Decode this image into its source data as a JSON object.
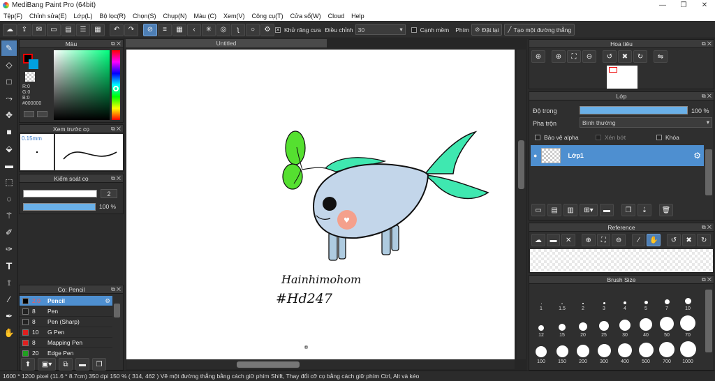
{
  "app": {
    "title": "MediBang Paint Pro (64bit)"
  },
  "menu": [
    "Tệp(F)",
    "Chỉnh sửa(E)",
    "Lớp(L)",
    "Bộ lọc(R)",
    "Chọn(S)",
    "Chụp(N)",
    "Màu (C)",
    "Xem(V)",
    "Công cụ(T)",
    "Cửa sổ(W)",
    "Cloud",
    "Help"
  ],
  "toolbar": {
    "antialias": "Khử răng cưa",
    "adjust": "Điều chỉnh",
    "adjust_value": "30",
    "edge": "Cạnh mềm",
    "key_label": "Phím",
    "reset": "Đặt lại",
    "straight_line": "Tạo một đường thẳng"
  },
  "color_panel": {
    "title": "Màu",
    "r": "R:0",
    "g": "G:0",
    "b": "B:0",
    "hex": "#000000",
    "fg": "#000000",
    "bg": "#00a0e0"
  },
  "brush_preview": {
    "title": "Xem trước cọ",
    "size": "0.15mm"
  },
  "brush_control": {
    "title": "Kiểm soát cọ",
    "size_value": "2",
    "opacity_value": "100 %"
  },
  "brush_list": {
    "title": "Cọ: Pencil",
    "items": [
      {
        "size": "2.0",
        "name": "Pencil",
        "color": "#000000",
        "selected": true
      },
      {
        "size": "8",
        "name": "Pen",
        "color": "#222222"
      },
      {
        "size": "8",
        "name": "Pen (Sharp)",
        "color": "#222222"
      },
      {
        "size": "10",
        "name": "G Pen",
        "color": "#e02020"
      },
      {
        "size": "8",
        "name": "Mapping Pen",
        "color": "#e02020"
      },
      {
        "size": "20",
        "name": "Edge Pen",
        "color": "#20a020"
      }
    ]
  },
  "canvas": {
    "tab": "Untitled",
    "handwriting_1": "Hainhimohom",
    "handwriting_2": "#Hd247"
  },
  "navigator": {
    "title": "Hoa tiêu"
  },
  "layer": {
    "title": "Lớp",
    "opacity_label": "Độ trong",
    "opacity_value": "100 %",
    "blend_label": "Pha trộn",
    "blend_value": "Bình thường",
    "protect_alpha": "Bảo vệ alpha",
    "clipping": "Xén bớt",
    "lock": "Khóa",
    "layer_name": "Lớp1"
  },
  "reference": {
    "title": "Reference"
  },
  "brush_size": {
    "title": "Brush Size",
    "sizes": [
      "1",
      "1.5",
      "2",
      "3",
      "4",
      "5",
      "7",
      "10",
      "12",
      "15",
      "20",
      "25",
      "30",
      "40",
      "50",
      "70",
      "100",
      "150",
      "200",
      "300",
      "400",
      "500",
      "700",
      "1000"
    ]
  },
  "status": {
    "text": "1600 * 1200 pixel   (11.6 * 8.7cm)   350 dpi   150 %   ( 314, 462 )   Vẽ một đường thẳng bằng cách giữ phím Shift, Thay đổi cỡ cọ bằng cách giữ phím Ctrl, Alt và kéo"
  }
}
